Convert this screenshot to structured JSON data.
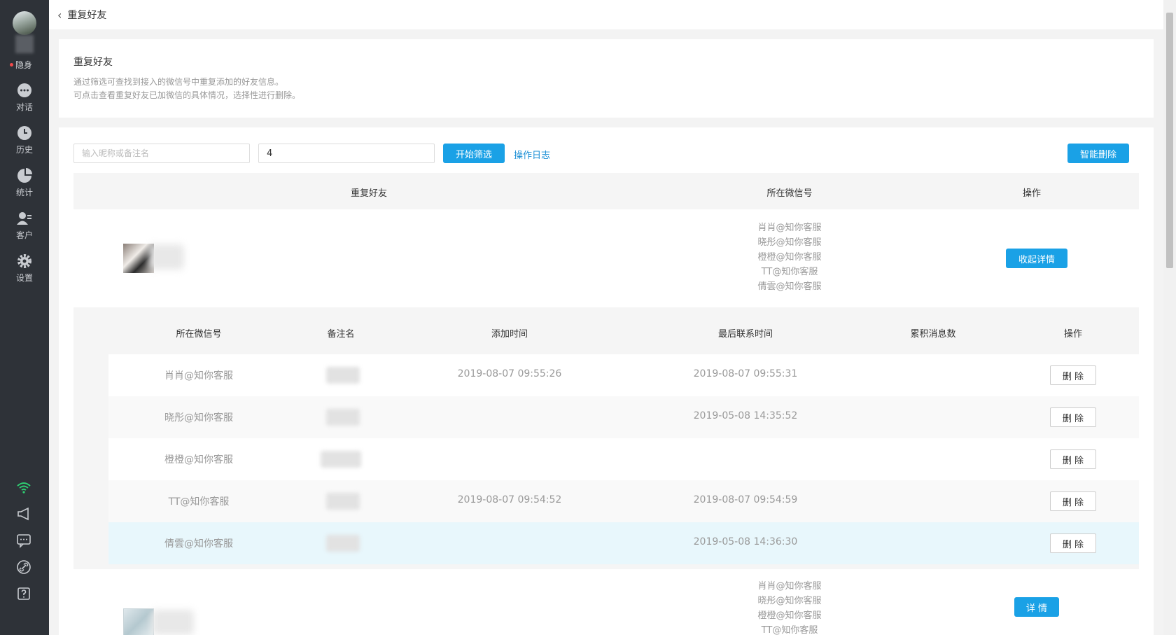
{
  "sidebar": {
    "status_label": "隐身",
    "items": [
      {
        "label": "对话",
        "icon": "chat-icon"
      },
      {
        "label": "历史",
        "icon": "clock-icon"
      },
      {
        "label": "统计",
        "icon": "pie-chart-icon"
      },
      {
        "label": "客户",
        "icon": "customer-icon"
      },
      {
        "label": "设置",
        "icon": "gear-icon"
      }
    ],
    "bottom_icons": [
      "wifi-icon",
      "megaphone-icon",
      "message-icon",
      "link-icon",
      "help-icon"
    ]
  },
  "header": {
    "title": "重复好友"
  },
  "info": {
    "title": "重复好友",
    "line1": "通过筛选可查找到接入的微信号中重复添加的好友信息。",
    "line2": "可点击查看重复好友已加微信的具体情况，选择性进行删除。"
  },
  "toolbar": {
    "search_placeholder": "输入昵称或备注名",
    "count_value": "4",
    "filter_label": "开始筛选",
    "log_label": "操作日志",
    "smart_delete_label": "智能删除"
  },
  "table": {
    "headers": {
      "friend": "重复好友",
      "account": "所在微信号",
      "action": "操作"
    }
  },
  "groups": [
    {
      "accounts": [
        "肖肖@知你客服",
        "晓彤@知你客服",
        "橙橙@知你客服",
        "TT@知你客服",
        "倩雲@知你客服"
      ],
      "action_label": "收起详情"
    },
    {
      "accounts": [
        "肖肖@知你客服",
        "晓彤@知你客服",
        "橙橙@知你客服",
        "TT@知你客服"
      ],
      "action_label": "详 情"
    }
  ],
  "detail": {
    "headers": {
      "account": "所在微信号",
      "remark": "备注名",
      "add_time": "添加时间",
      "last_contact": "最后联系时间",
      "msg_count": "累积消息数",
      "action": "操作"
    },
    "rows": [
      {
        "account": "肖肖@知你客服",
        "add_time": "2019-08-07 09:55:26",
        "last_contact": "2019-08-07 09:55:31",
        "delete_label": "删 除"
      },
      {
        "account": "晓彤@知你客服",
        "add_time": "",
        "last_contact": "2019-05-08 14:35:52",
        "delete_label": "删 除"
      },
      {
        "account": "橙橙@知你客服",
        "add_time": "",
        "last_contact": "",
        "delete_label": "删 除"
      },
      {
        "account": "TT@知你客服",
        "add_time": "2019-08-07 09:54:52",
        "last_contact": "2019-08-07 09:54:59",
        "delete_label": "删 除"
      },
      {
        "account": "倩雲@知你客服",
        "add_time": "",
        "last_contact": "2019-05-08 14:36:30",
        "delete_label": "删 除"
      }
    ]
  },
  "colors": {
    "sidebar_bg": "#2e3238",
    "primary": "#1aa1e6",
    "link": "#1a8fd6",
    "status_dot": "#f24a4a",
    "wifi": "#2ecc71"
  }
}
